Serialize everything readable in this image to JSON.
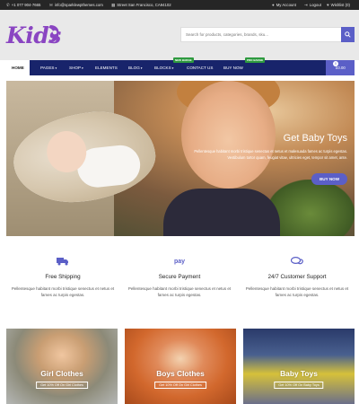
{
  "topbar": {
    "phone": "+1 077 904-7665",
    "email": "info@sparklewpthemes.com",
    "address": "Street San Francisco, CA94102",
    "my_account": "My Account",
    "logout": "Logout",
    "wishlist": "Wishlist (0)"
  },
  "header": {
    "logo_text": "Kids",
    "search_placeholder": "Search for products, categories, brands, sku..."
  },
  "nav": {
    "items": [
      {
        "label": "HOME"
      },
      {
        "label": "PAGES"
      },
      {
        "label": "SHOP"
      },
      {
        "label": "ELEMENTS"
      },
      {
        "label": "BLOG"
      },
      {
        "label": "BLOCKS"
      },
      {
        "label": "CONTACT US"
      },
      {
        "label": "BUY NOW"
      }
    ],
    "badges": {
      "blocks": "NEW BADGE",
      "buy_now": "PRO BADGE"
    },
    "cart_count": "0",
    "cart_total": "£0.00"
  },
  "hero": {
    "title": "Get Baby Toys",
    "description": "Pellentesque habitant morbi tristique senectus et netus et malesuada fames ac turpis egestas. Vestibulum tortor quam, feugiat vitae, ultricies eget, tempor sit amet, ante.",
    "button": "BUY NOW"
  },
  "features": [
    {
      "icon": "truck-icon",
      "title": "Free Shipping",
      "desc": "Pellentesque habitant morbi tristique senectus et netus et fames ac turpis egestas."
    },
    {
      "icon": "pay-icon",
      "title": "Secure Payment",
      "desc": "Pellentesque habitant morbi tristique senectus et netus et fames ac turpis egestas."
    },
    {
      "icon": "chat-icon",
      "title": "24/7 Customer Support",
      "desc": "Pellentesque habitant morbi tristique senectus et netus et fames ac turpis egestas."
    }
  ],
  "categories": [
    {
      "title": "Girl Clothes",
      "sub": "Get 10% Off On Girl Clothes"
    },
    {
      "title": "Boys Clothes",
      "sub": "Get 10% Off On Girl Clothes"
    },
    {
      "title": "Baby Toys",
      "sub": "Get 10% Off On Baby Toys"
    }
  ],
  "colors": {
    "accent": "#5b5fc7",
    "nav_bg": "#18246b",
    "logo": "#8a45c2",
    "topbar_bg": "#262626"
  }
}
